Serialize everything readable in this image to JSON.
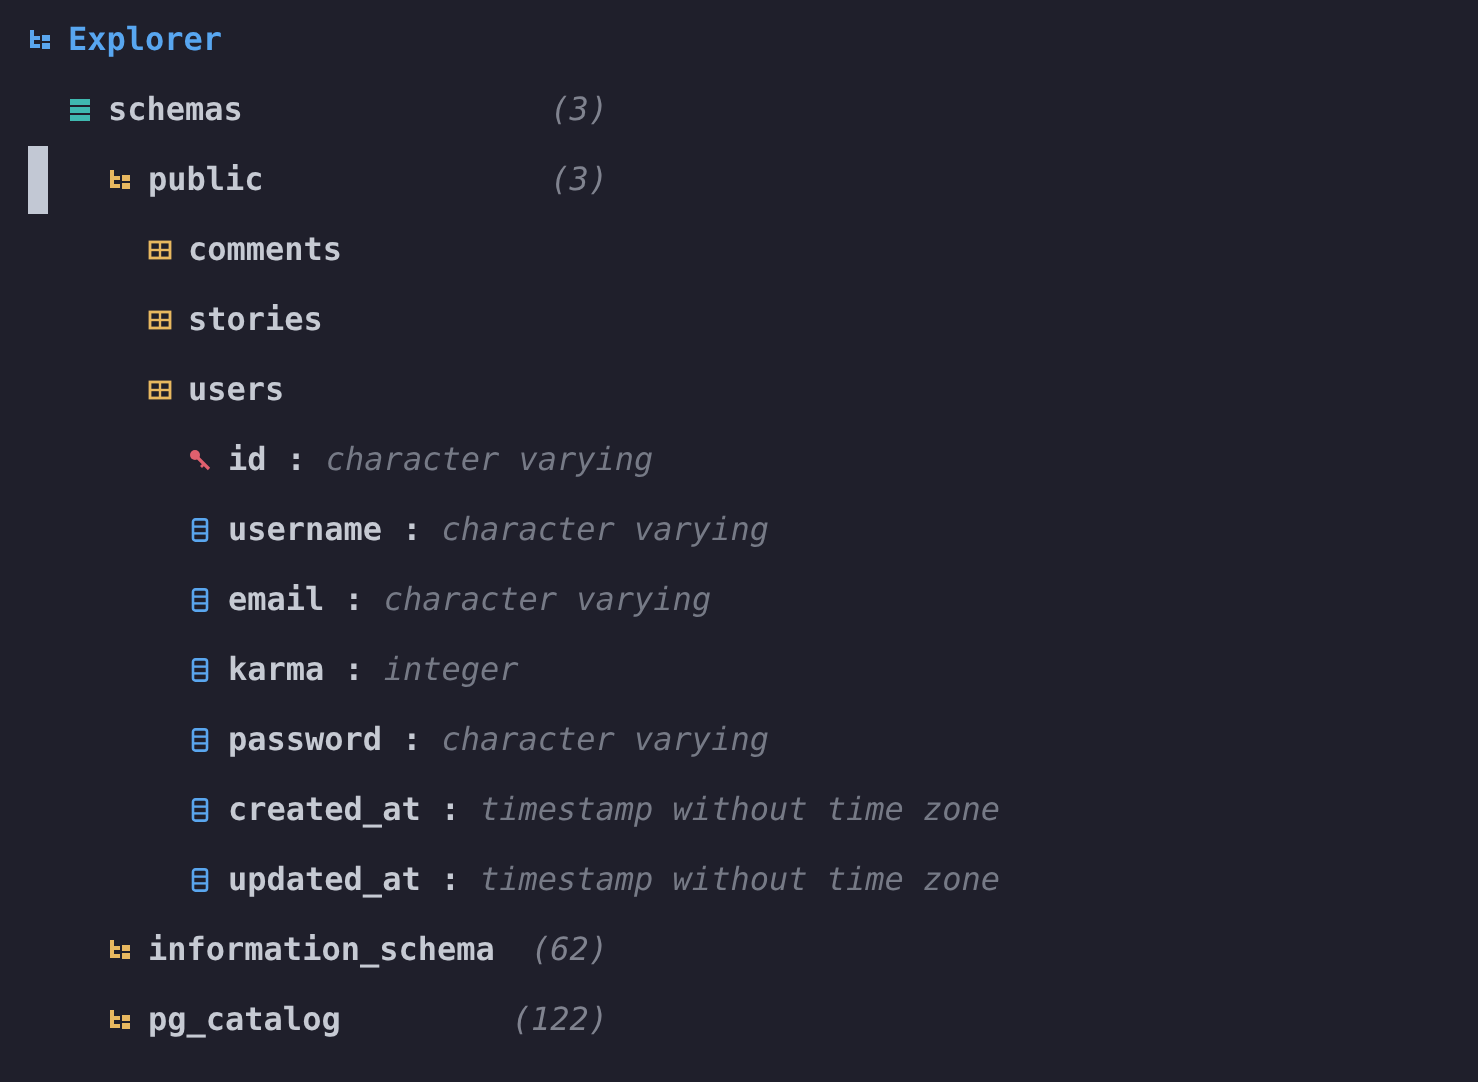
{
  "header": {
    "title": "Explorer"
  },
  "tree": [
    {
      "kind": "database",
      "name": "schemas",
      "count": "(3)",
      "selected": false,
      "children": [
        {
          "kind": "schema",
          "name": "public",
          "count": "(3)",
          "selected": true,
          "children": [
            {
              "kind": "table",
              "name": "comments",
              "selected": false
            },
            {
              "kind": "table",
              "name": "stories",
              "selected": false
            },
            {
              "kind": "table",
              "name": "users",
              "selected": false,
              "children": [
                {
                  "kind": "key",
                  "name": "id",
                  "separator": ":",
                  "type": "character varying",
                  "selected": false
                },
                {
                  "kind": "column",
                  "name": "username",
                  "separator": ":",
                  "type": "character varying",
                  "selected": false
                },
                {
                  "kind": "column",
                  "name": "email",
                  "separator": ":",
                  "type": "character varying",
                  "selected": false
                },
                {
                  "kind": "column",
                  "name": "karma",
                  "separator": ":",
                  "type": "integer",
                  "selected": false
                },
                {
                  "kind": "column",
                  "name": "password",
                  "separator": ":",
                  "type": "character varying",
                  "selected": false
                },
                {
                  "kind": "column",
                  "name": "created_at",
                  "separator": ":",
                  "type": "timestamp without time zone",
                  "selected": false
                },
                {
                  "kind": "column",
                  "name": "updated_at",
                  "separator": ":",
                  "type": "timestamp without time zone",
                  "selected": false
                }
              ]
            }
          ]
        },
        {
          "kind": "schema",
          "name": "information_schema",
          "count": "(62)",
          "selected": false
        },
        {
          "kind": "schema",
          "name": "pg_catalog",
          "count": "(122)",
          "selected": false
        }
      ]
    }
  ]
}
